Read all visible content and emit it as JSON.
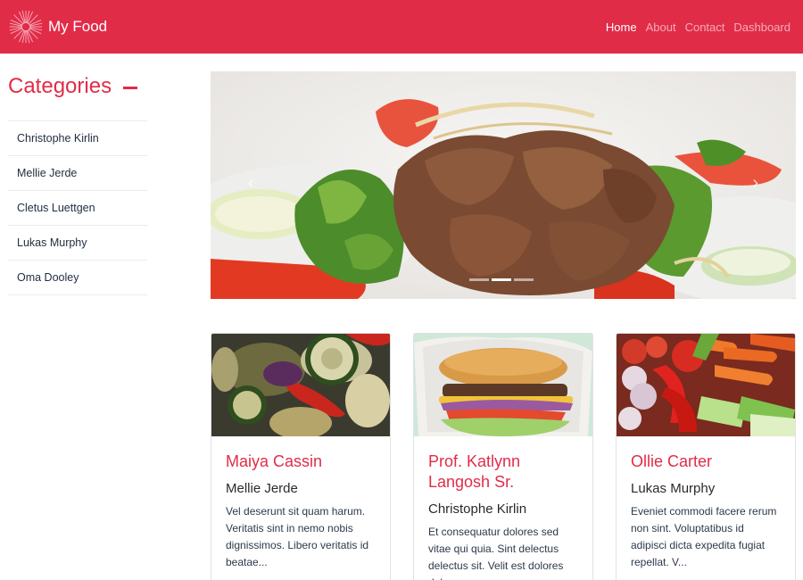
{
  "app": {
    "brand": "My Food",
    "logo_icon": "starburst-logo-icon",
    "accent_color": "#e12c48"
  },
  "nav": {
    "items": [
      {
        "label": "Home",
        "active": true
      },
      {
        "label": "About",
        "active": false
      },
      {
        "label": "Contact",
        "active": false
      },
      {
        "label": "Dashboard",
        "active": false
      }
    ]
  },
  "sidebar": {
    "title": "Categories",
    "toggle_icon": "minus-icon",
    "items": [
      {
        "label": "Christophe Kirlin"
      },
      {
        "label": "Mellie Jerde"
      },
      {
        "label": "Cletus Luettgen"
      },
      {
        "label": "Lukas Murphy"
      },
      {
        "label": "Oma Dooley"
      }
    ]
  },
  "carousel": {
    "image": "grilled-beef-salad-photo",
    "prev_icon": "‹",
    "next_icon": "›",
    "slide_count": 3,
    "active_slide": 2
  },
  "cards": [
    {
      "image": "grilled-vegetables-photo",
      "title": "Maiya Cassin",
      "category": "Mellie Jerde",
      "excerpt": "Vel deserunt sit quam harum. Veritatis sint in nemo nobis dignissimos. Libero veritatis id beatae..."
    },
    {
      "image": "burger-wrap-photo",
      "title": "Prof. Katlynn Langosh Sr.",
      "category": "Christophe Kirlin",
      "excerpt": "Et consequatur dolores sed vitae qui quia. Sint delectus delectus sit. Velit est dolores dolorem..."
    },
    {
      "image": "fresh-vegetables-photo",
      "title": "Ollie Carter",
      "category": "Lukas Murphy",
      "excerpt": "Eveniet commodi facere rerum non sint. Voluptatibus id adipisci dicta expedita fugiat repellat. V..."
    }
  ]
}
